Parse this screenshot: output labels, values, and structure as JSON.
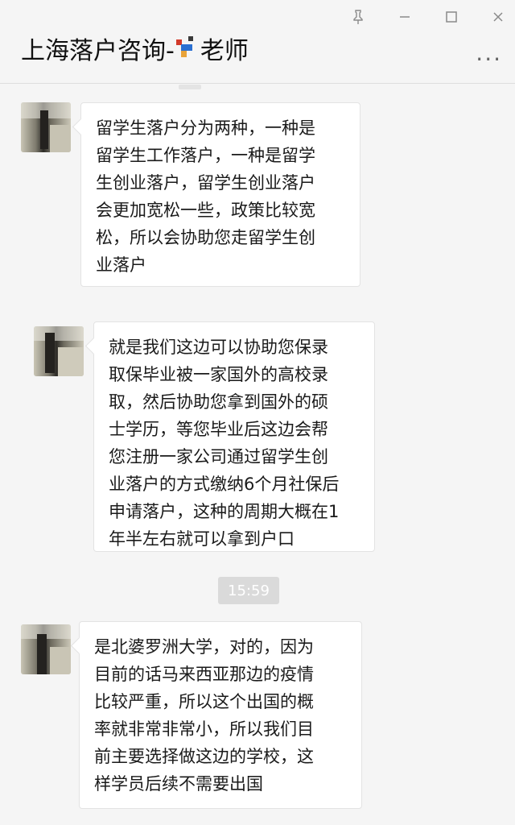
{
  "window": {
    "title_prefix": "上海落户咨询-",
    "title_suffix": "老师",
    "controls": {
      "pin": "📌",
      "minimize": "—",
      "maximize": "☐",
      "close": "✕"
    },
    "more": "···"
  },
  "messages": [
    {
      "text": "留学生落户分为两种，一种是\n留学生工作落户，一种是留学\n生创业落户，留学生创业落户\n会更加宽松一些，政策比较宽\n松，所以会协助您走留学生创\n业落户"
    },
    {
      "text": "就是我们这边可以协助您保录\n取保毕业被一家国外的高校录\n取，然后协助您拿到国外的硕\n士学历，等您毕业后这边会帮\n您注册一家公司通过留学生创\n业落户的方式缴纳6个月社保后\n申请落户，这种的周期大概在1\n年半左右就可以拿到户口"
    },
    {
      "text": "是北婆罗洲大学，对的，因为\n目前的话马来西亚那边的疫情\n比较严重，所以这个出国的概\n率就非常非常小，所以我们目\n前主要选择做这边的学校，这\n样学员后续不需要出国"
    }
  ],
  "timestamp": "15:59"
}
